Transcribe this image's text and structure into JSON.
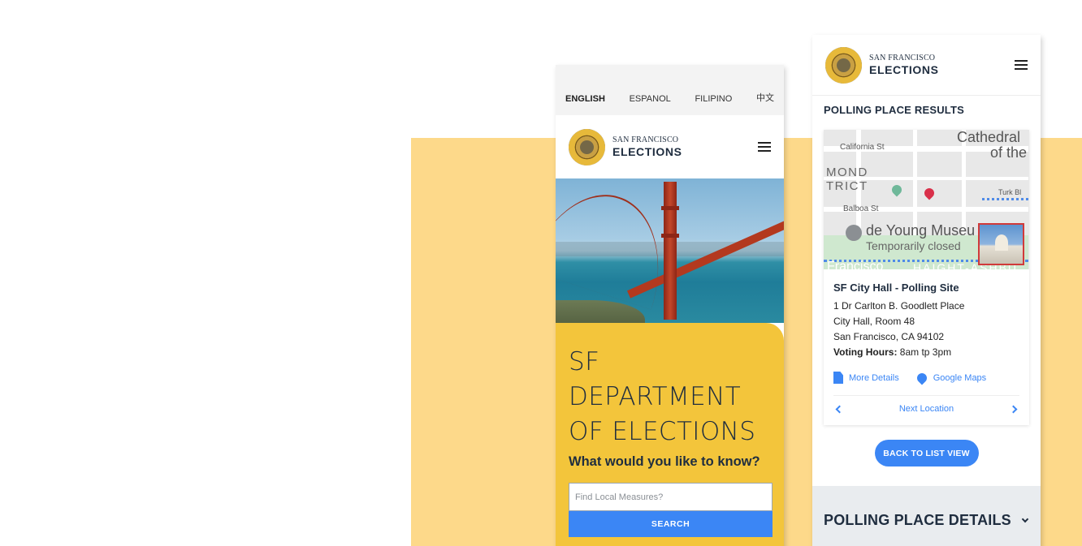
{
  "left_phone": {
    "languages": [
      "ENGLISH",
      "ESPANOL",
      "FILIPINO",
      "中文"
    ],
    "brand": {
      "top": "SAN FRANCISCO",
      "main": "ELECTIONS"
    },
    "hero_title_lines": [
      "SF",
      "DEPARTMENT",
      "OF ELECTIONS"
    ],
    "question": "What would you like to know?",
    "search": {
      "placeholder": "Find Local Measures?",
      "button_label": "SEARCH"
    }
  },
  "right_phone": {
    "brand": {
      "top": "SAN FRANCISCO",
      "main": "ELECTIONS"
    },
    "section_title": "POLLING PLACE RESULTS",
    "map_labels": {
      "cathedral": "Cathedral",
      "of_the": "of the",
      "california_st": "California St",
      "mond": "MOND",
      "trict": "TRICT",
      "turk": "Turk Bl",
      "balboa_st": "Balboa St",
      "museum": "de Young Museu",
      "closed": "Temporarily closed",
      "francisco": "Francisco",
      "haight": "HAIGHT-ASHBU"
    },
    "place": {
      "name": "SF City Hall - Polling Site",
      "address_line1": "1 Dr Carlton B. Goodlett Place",
      "address_line2": "City Hall, Room 48",
      "address_line3": "San Francisco, CA 94102",
      "hours_label": "Voting Hours:",
      "hours_value": "8am tp 3pm"
    },
    "links": {
      "more_details": "More Details",
      "google_maps": "Google Maps"
    },
    "next_location": "Next Location",
    "back_button": "BACK TO LIST VIEW",
    "details_title": "POLLING PLACE DETAILS"
  },
  "colors": {
    "backdrop": "#fdd98a",
    "yellow_panel": "#f3c53b",
    "accent_blue": "#3b86f5",
    "navy": "#1f2d3f"
  },
  "icons": [
    "seal-logo",
    "hamburger-menu-icon",
    "document-icon",
    "map-pin-icon",
    "chevron-left-icon",
    "chevron-right-icon",
    "chevron-down-icon"
  ]
}
